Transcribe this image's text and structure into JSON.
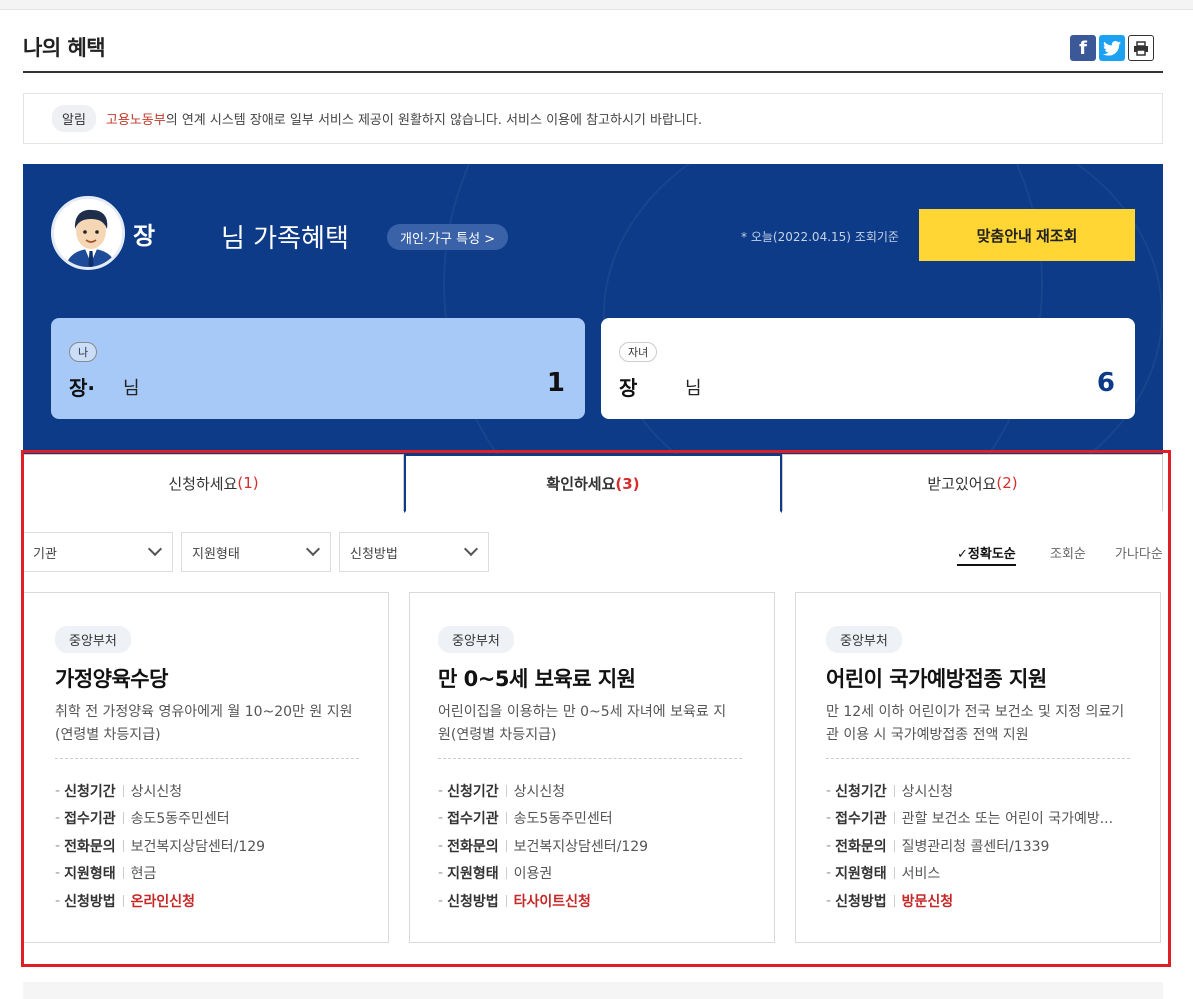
{
  "page": {
    "title": "나의 혜택"
  },
  "share": {
    "facebook_icon": "facebook-icon",
    "twitter_icon": "twitter-icon",
    "print_icon": "print-icon"
  },
  "notice": {
    "badge": "알림",
    "org": "고용노동부",
    "text": "의 연계 시스템 장애로 일부 서비스 제공이 원활하지 않습니다. 서비스 이용에 참고하시기 바랍니다."
  },
  "hero": {
    "name": "장",
    "suffix": "님 가족혜택",
    "pill": "개인·가구 특성 >",
    "date_note": "* 오늘(2022.04.15) 조회기준",
    "refresh_button": "맞춤안내 재조회"
  },
  "members": [
    {
      "badge": "나",
      "name": "장·",
      "suffix": "님",
      "count": "1"
    },
    {
      "badge": "자녀",
      "name": "장",
      "suffix": "님",
      "count": "6"
    }
  ],
  "tabs": [
    {
      "label": "신청하세요",
      "count": "(1)"
    },
    {
      "label": "확인하세요",
      "count": "(3)"
    },
    {
      "label": "받고있어요",
      "count": "(2)"
    }
  ],
  "filters": [
    {
      "value": "기관"
    },
    {
      "value": "지원형태"
    },
    {
      "value": "신청방법"
    }
  ],
  "sort": {
    "options": [
      "✓정확도순",
      "조회순",
      "가나다순"
    ]
  },
  "cards": [
    {
      "badge": "중앙부처",
      "title": "가정양육수당",
      "desc": "취학 전 가정양육 영유아에게 월 10~20만 원 지원(연령별 차등지급)",
      "rows": [
        {
          "k": "신청기간",
          "v": "상시신청"
        },
        {
          "k": "접수기관",
          "v": "송도5동주민센터"
        },
        {
          "k": "전화문의",
          "v": "보건복지상담센터/129"
        },
        {
          "k": "지원형태",
          "v": "현금"
        },
        {
          "k": "신청방법",
          "v": "온라인신청"
        }
      ]
    },
    {
      "badge": "중앙부처",
      "title": "만 0~5세 보육료 지원",
      "desc": "어린이집을 이용하는 만 0~5세 자녀에 보육료 지원(연령별 차등지급)",
      "rows": [
        {
          "k": "신청기간",
          "v": "상시신청"
        },
        {
          "k": "접수기관",
          "v": "송도5동주민센터"
        },
        {
          "k": "전화문의",
          "v": "보건복지상담센터/129"
        },
        {
          "k": "지원형태",
          "v": "이용권"
        },
        {
          "k": "신청방법",
          "v": "타사이트신청"
        }
      ]
    },
    {
      "badge": "중앙부처",
      "title": "어린이 국가예방접종 지원",
      "desc": "만 12세 이하 어린이가 전국 보건소 및 지정 의료기관 이용 시 국가예방접종 전액 지원",
      "rows": [
        {
          "k": "신청기간",
          "v": "상시신청"
        },
        {
          "k": "접수기관",
          "v": "관할 보건소 또는 어린이 국가예방..."
        },
        {
          "k": "전화문의",
          "v": "질병관리청 콜센터/1339"
        },
        {
          "k": "지원형태",
          "v": "서비스"
        },
        {
          "k": "신청방법",
          "v": "방문신청"
        }
      ]
    }
  ]
}
